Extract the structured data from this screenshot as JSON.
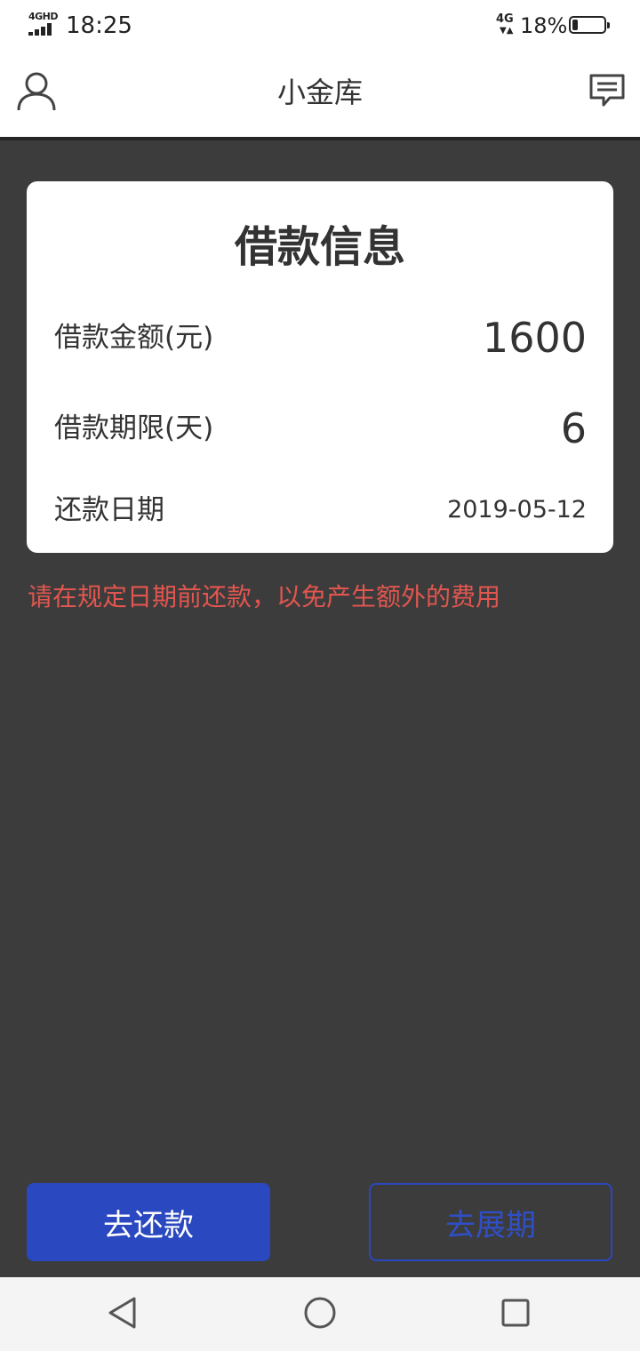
{
  "status_bar": {
    "network_type": "4GHD",
    "time": "18:25",
    "right_network": "4G",
    "battery_percent": "18%",
    "battery_level": 0.18
  },
  "header": {
    "title": "小金库",
    "left_icon": "user-icon",
    "right_icon": "message-icon"
  },
  "loan_card": {
    "title": "借款信息",
    "rows": [
      {
        "label": "借款金额(元)",
        "value": "1600"
      },
      {
        "label": "借款期限(天)",
        "value": "6"
      },
      {
        "label": "还款日期",
        "value": "2019-05-12"
      }
    ]
  },
  "notice": "请在规定日期前还款，以免产生额外的费用",
  "buttons": {
    "repay": "去还款",
    "extend": "去展期"
  },
  "nav": {
    "back_icon": "back-triangle-icon",
    "home_icon": "home-circle-icon",
    "recent_icon": "recent-square-icon"
  },
  "colors": {
    "accent": "#2a48bf",
    "notice": "#e2564f",
    "background": "#3c3c3c"
  }
}
